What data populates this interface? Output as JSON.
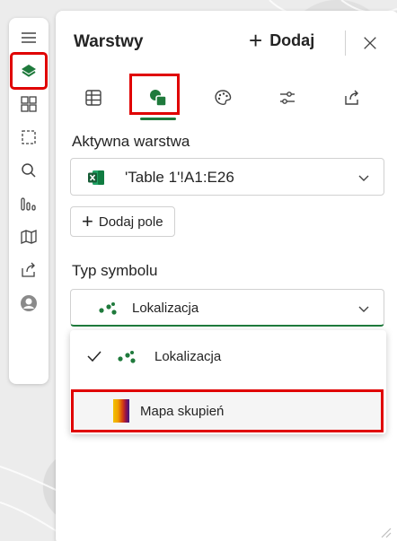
{
  "rail": {
    "items": [
      {
        "name": "menu-icon"
      },
      {
        "name": "layers-icon"
      },
      {
        "name": "grid-icon"
      },
      {
        "name": "select-area-icon"
      },
      {
        "name": "search-icon"
      },
      {
        "name": "chart-icon"
      },
      {
        "name": "map-icon"
      },
      {
        "name": "share-icon"
      },
      {
        "name": "avatar"
      }
    ],
    "active_index": 1
  },
  "panel": {
    "title": "Warstwy",
    "add_label": "Dodaj",
    "tabs": [
      {
        "name": "table-icon"
      },
      {
        "name": "shapes-icon"
      },
      {
        "name": "palette-icon"
      },
      {
        "name": "settings-sliders-icon"
      },
      {
        "name": "share-icon"
      }
    ],
    "active_tab": 1
  },
  "active_layer": {
    "label": "Aktywna warstwa",
    "value": "'Table 1'!A1:E26",
    "icon": "excel-icon"
  },
  "add_field": {
    "label": "Dodaj pole"
  },
  "symbol_type": {
    "label": "Typ symbolu",
    "selected": "Lokalizacja",
    "options": [
      {
        "label": "Lokalizacja",
        "checked": true,
        "icon": "dots-icon"
      },
      {
        "label": "Mapa skupień",
        "checked": false,
        "icon": "heatmap-icon"
      }
    ]
  },
  "colors": {
    "accent_green": "#1f7a3c",
    "highlight_red": "#e00000"
  }
}
